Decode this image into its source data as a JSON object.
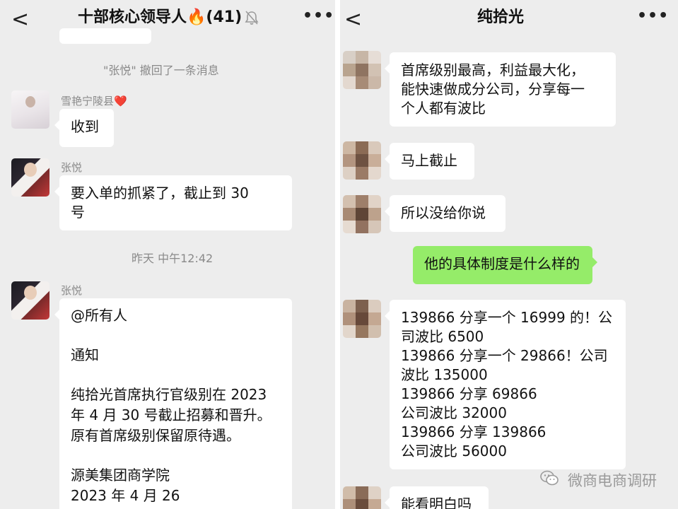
{
  "left_chat": {
    "back_glyph": "<",
    "title": "十部核心领导人🔥(41)",
    "more_glyph": "•••",
    "recall_notice": "\"张悦\" 撤回了一条消息",
    "timestamp": "昨天 中午12:42",
    "messages": [
      {
        "sender": "雪艳宁陵县❤️",
        "lines": [
          "收到"
        ]
      },
      {
        "sender": "张悦",
        "lines": [
          "要入单的抓紧了，截止到 30",
          "号"
        ]
      },
      {
        "sender": "张悦",
        "lines": [
          "@所有人",
          "",
          "通知",
          "",
          "纯拾光首席执行官级别在 2023",
          "年 4 月 30 号截止招募和晋升。",
          "原有首席级别保留原待遇。",
          "",
          "源美集团商学院",
          "2023 年 4 月 26"
        ]
      }
    ]
  },
  "right_chat": {
    "back_glyph": "<",
    "title": "纯拾光",
    "more_glyph": "•••",
    "messages": [
      {
        "from": "other",
        "lines": [
          "首席级别最高，利益最大化，",
          "能快速做成分公司，分享每一",
          "个人都有波比"
        ]
      },
      {
        "from": "other",
        "lines": [
          "马上截止"
        ]
      },
      {
        "from": "other",
        "lines": [
          "所以没给你说"
        ]
      },
      {
        "from": "self",
        "lines": [
          "他的具体制度是什么样的"
        ]
      },
      {
        "from": "other",
        "lines": [
          "139866 分享一个 16999 的！公",
          "司波比 6500",
          "139866 分享一个 29866！公司",
          "波比 135000",
          "139866 分享 69866",
          "公司波比 32000",
          "139866 分享 139866",
          "公司波比 56000"
        ]
      },
      {
        "from": "other",
        "lines": [
          "能看明白吗"
        ]
      }
    ]
  },
  "watermark": {
    "text": "微商电商调研"
  },
  "colors": {
    "chat_background": "#ededed",
    "incoming_bubble": "#ffffff",
    "outgoing_bubble": "#95ec69",
    "system_text": "#8a8a8a"
  },
  "icons": [
    "back-arrow-icon",
    "more-dots-icon",
    "muted-bell-icon",
    "fire-emoji",
    "heart-emoji",
    "wechat-logo-icon"
  ]
}
